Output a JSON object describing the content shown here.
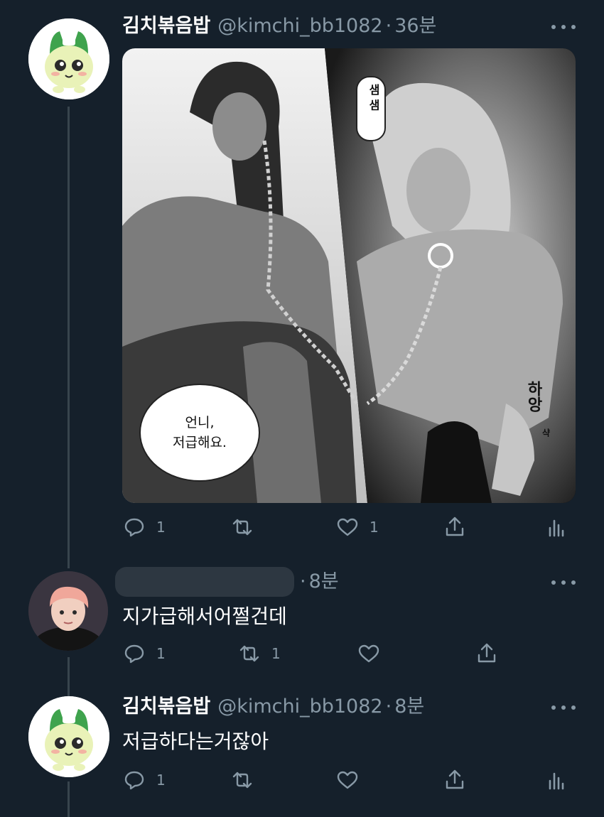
{
  "tweets": [
    {
      "display_name": "김치볶음밥",
      "handle": "@kimchi_bb1082",
      "separator": "·",
      "time": "36분",
      "avatar_icon": "green-mascot-avatar",
      "media": {
        "speech_bubble_line1": "언니,",
        "speech_bubble_line2": "저급해요.",
        "sfx_top": "샘 샘",
        "sfx_right": "하앙",
        "sfx_small": "샥"
      },
      "reply_count": "1",
      "retweet_count": "",
      "like_count": "1"
    },
    {
      "display_name": "",
      "separator": "·",
      "time": "8분",
      "avatar_icon": "person-photo-avatar",
      "text": "지가급해서어쩔건데",
      "reply_count": "1",
      "retweet_count": "1",
      "like_count": ""
    },
    {
      "display_name": "김치볶음밥",
      "handle": "@kimchi_bb1082",
      "separator": "·",
      "time": "8분",
      "avatar_icon": "green-mascot-avatar",
      "text": "저급하다는거잖아",
      "reply_count": "1",
      "retweet_count": "",
      "like_count": ""
    }
  ],
  "colors": {
    "background": "#15202b",
    "secondary_text": "#8899a6",
    "thread_line": "#38444d",
    "mascot_green": "#4caf50"
  }
}
